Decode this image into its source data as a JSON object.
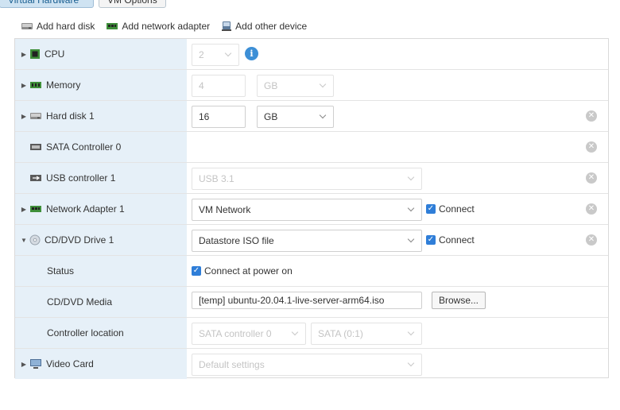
{
  "tabs": {
    "virtual_hardware": "Virtual Hardware",
    "vm_options": "VM Options"
  },
  "toolbar": {
    "add_hard_disk": "Add hard disk",
    "add_network_adapter": "Add network adapter",
    "add_other_device": "Add other device"
  },
  "rows": {
    "cpu": {
      "label": "CPU",
      "value": "2",
      "icon": "cpu-icon"
    },
    "memory": {
      "label": "Memory",
      "value": "4",
      "unit": "GB",
      "icon": "memory-icon"
    },
    "hard_disk": {
      "label": "Hard disk 1",
      "value": "16",
      "unit": "GB",
      "icon": "hard-disk-icon"
    },
    "sata": {
      "label": "SATA Controller 0",
      "icon": "sata-icon"
    },
    "usb": {
      "label": "USB controller 1",
      "value": "USB 3.1",
      "icon": "usb-icon"
    },
    "network": {
      "label": "Network Adapter 1",
      "value": "VM Network",
      "connect": "Connect",
      "icon": "network-adapter-icon"
    },
    "cdrom": {
      "label": "CD/DVD Drive 1",
      "value": "Datastore ISO file",
      "connect": "Connect",
      "icon": "cd-dvd-icon"
    },
    "status": {
      "label": "Status",
      "value": "Connect at power on"
    },
    "media": {
      "label": "CD/DVD Media",
      "value": "[temp] ubuntu-20.04.1-live-server-arm64.iso",
      "browse": "Browse..."
    },
    "controller": {
      "label": "Controller location",
      "controller": "SATA controller 0",
      "port": "SATA (0:1)"
    },
    "video": {
      "label": "Video Card",
      "value": "Default settings",
      "icon": "video-card-icon"
    }
  },
  "colors": {
    "label_bg": "#e6f0f8",
    "checkbox": "#2f7ed8",
    "info": "#3d8fd6"
  }
}
